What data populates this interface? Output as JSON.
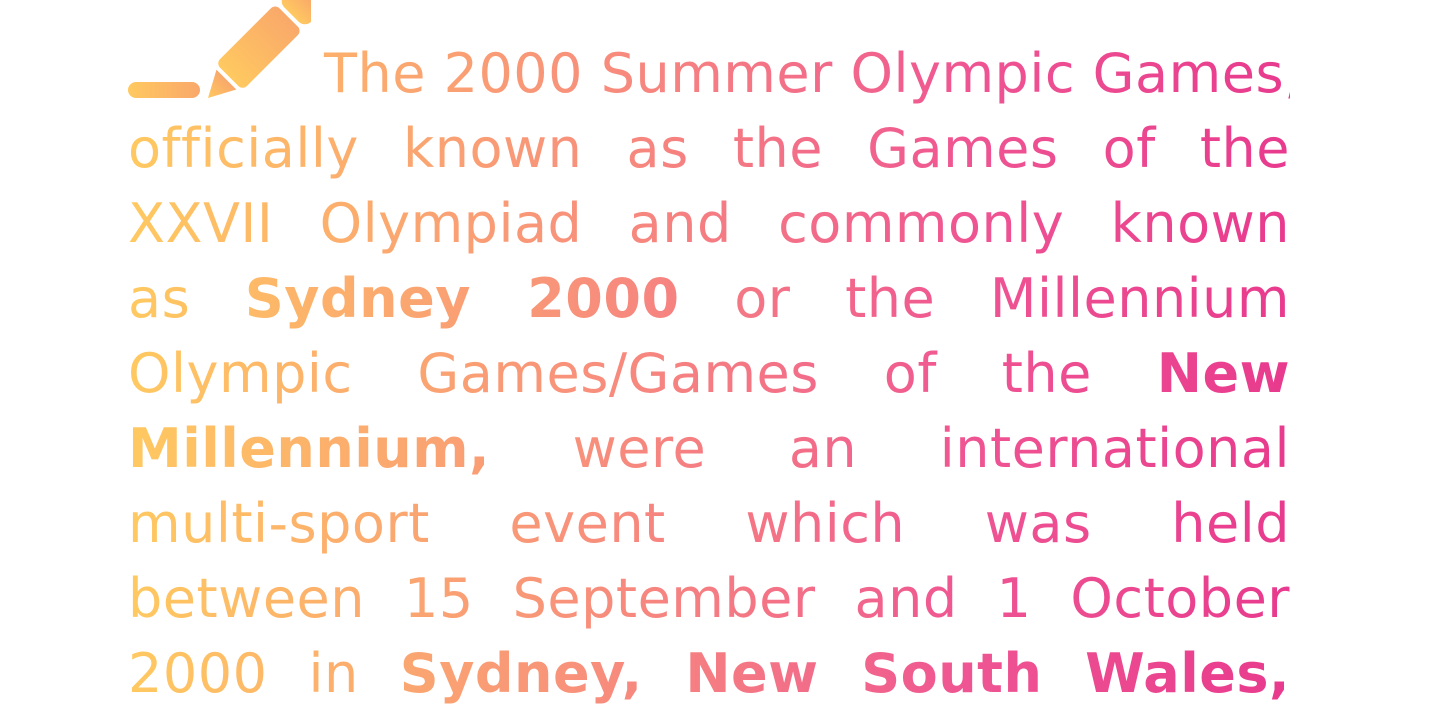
{
  "paragraph": {
    "line1": "The 2000 Summer Olympic Games,",
    "line2": "officially known as the Games of the",
    "line3": "XXVII Olympiad and commonly known",
    "line4_a": "as ",
    "line4_b": "Sydney 2000",
    "line4_c": " or the Millennium",
    "line5_a": "Olympic Games/Games of the ",
    "line5_b": "New",
    "line6_a": "Millennium,",
    "line6_b": " were an international",
    "line7": "multi-sport event which was held",
    "line8": "between 15 September and 1 October",
    "line9_a": "2000 in ",
    "line9_b": "Sydney, New South Wales,"
  },
  "colors": {
    "gradient_start": "#ffc960",
    "gradient_mid": "#f8927a",
    "gradient_end": "#e83a8e"
  },
  "icons": {
    "decoration": "pencil-icon"
  }
}
